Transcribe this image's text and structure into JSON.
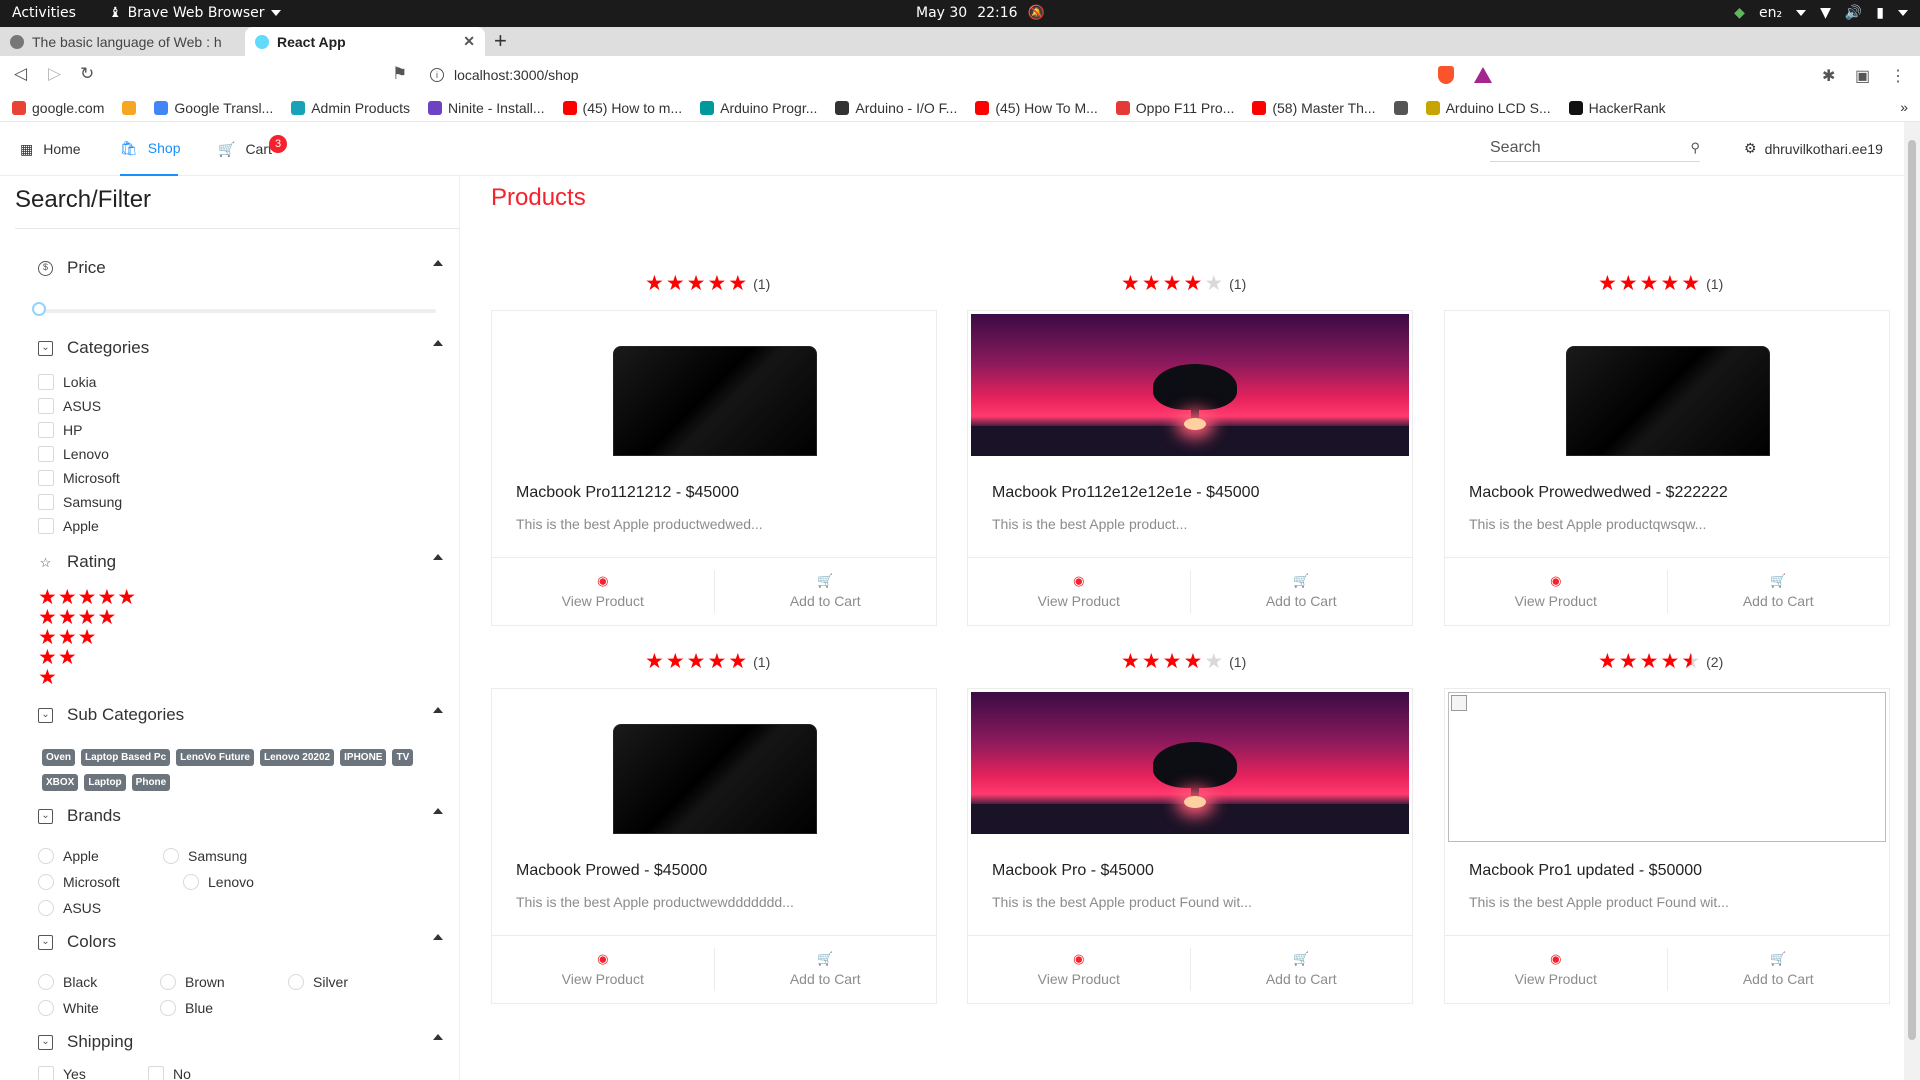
{
  "os": {
    "activities": "Activities",
    "app_name": "Brave Web Browser",
    "date": "May 30",
    "time": "22:16",
    "lang": "en₂"
  },
  "browser": {
    "tabs": [
      {
        "title": "The basic language of Web : h"
      },
      {
        "title": "React App"
      }
    ],
    "url": "localhost:3000/shop",
    "bookmarks": [
      {
        "label": "google.com",
        "color": "#ea4335"
      },
      {
        "label": "",
        "color": "#f5a623"
      },
      {
        "label": "Google Transl...",
        "color": "#4285f4"
      },
      {
        "label": "Admin Products",
        "color": "#17a2b8"
      },
      {
        "label": "Ninite - Install...",
        "color": "#6f42c1"
      },
      {
        "label": "(45) How to m...",
        "color": "#ff0000"
      },
      {
        "label": "Arduino Progr...",
        "color": "#00979d"
      },
      {
        "label": "Arduino - I/O F...",
        "color": "#333333"
      },
      {
        "label": "(45) How To M...",
        "color": "#ff0000"
      },
      {
        "label": "Oppo F11 Pro...",
        "color": "#e53935"
      },
      {
        "label": "(58) Master Th...",
        "color": "#ff0000"
      },
      {
        "label": "",
        "color": "#555555"
      },
      {
        "label": "Arduino LCD S...",
        "color": "#c8a400"
      },
      {
        "label": "HackerRank",
        "color": "#111111"
      }
    ],
    "more": "»"
  },
  "nav": {
    "home": "Home",
    "shop": "Shop",
    "cart": "Cart",
    "cart_count": "3",
    "search_placeholder": "Search",
    "user": "dhruvilkothari.ee19"
  },
  "sidebar": {
    "title": "Search/Filter",
    "price_label": "Price",
    "categories_label": "Categories",
    "categories": [
      "Lokia",
      "ASUS",
      "HP",
      "Lenovo",
      "Microsoft",
      "Samsung",
      "Apple"
    ],
    "rating_label": "Rating",
    "rating_rows": [
      "★★★★★",
      "★★★★",
      "★★★",
      "★★",
      "★"
    ],
    "subcategories_label": "Sub Categories",
    "subcategories": [
      "Oven",
      "Laptop Based Pc",
      "LenoVo Future",
      "Lenovo 20202",
      "IPHONE",
      "TV",
      "XBOX",
      "Laptop",
      "Phone"
    ],
    "brands_label": "Brands",
    "brands": [
      "Apple",
      "Samsung",
      "Microsoft",
      "Lenovo",
      "ASUS"
    ],
    "colors_label": "Colors",
    "colors": [
      "Black",
      "Brown",
      "Silver",
      "White",
      "Blue"
    ],
    "shipping_label": "Shipping",
    "shipping": [
      "Yes",
      "No"
    ]
  },
  "products": {
    "title": "Products",
    "view_label": "View Product",
    "cart_label": "Add to Cart",
    "items": [
      {
        "rating": 5,
        "count": "(1)",
        "image": "laptop",
        "title": "Macbook Pro1121212 - $45000",
        "desc": "This is the best Apple productwedwed..."
      },
      {
        "rating": 4,
        "count": "(1)",
        "image": "sunset",
        "title": "Macbook Pro112e12e12e1e - $45000",
        "desc": "This is the best Apple product..."
      },
      {
        "rating": 5,
        "count": "(1)",
        "image": "laptop",
        "title": "Macbook Prowedwedwed - $222222",
        "desc": "This is the best Apple productqwsqw..."
      },
      {
        "rating": 5,
        "count": "(1)",
        "image": "laptop",
        "title": "Macbook Prowed - $45000",
        "desc": "This is the best Apple productwewddddddd..."
      },
      {
        "rating": 4,
        "count": "(1)",
        "image": "sunset",
        "title": "Macbook Pro - $45000",
        "desc": "This is the best Apple product Found wit..."
      },
      {
        "rating": 4.5,
        "count": "(2)",
        "image": "broken",
        "title": "Macbook Pro1 updated - $50000",
        "desc": "This is the best Apple product Found wit..."
      }
    ]
  },
  "colors": {
    "accent": "#1890ff",
    "star": "#ff0000",
    "price_red": "#f5222d"
  }
}
